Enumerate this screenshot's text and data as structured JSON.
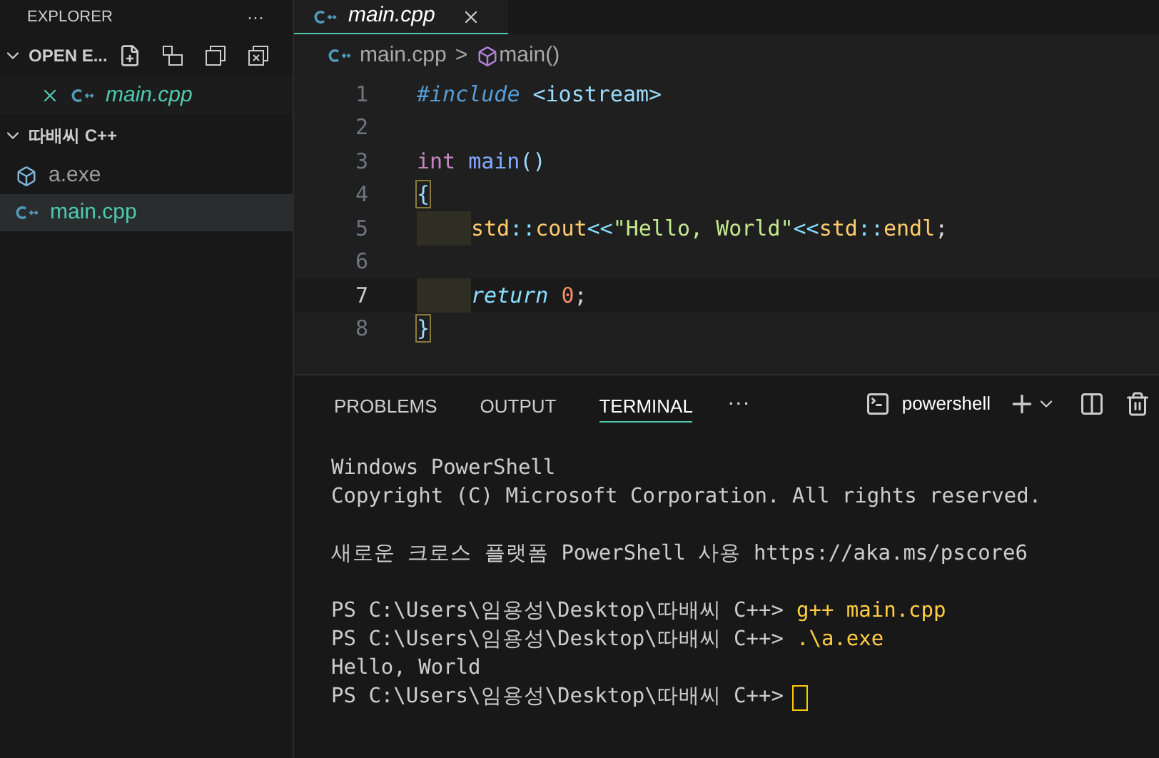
{
  "sidebar": {
    "title": "EXPLORER",
    "more": "···",
    "sections": [
      {
        "title": "OPEN E...",
        "expanded": true,
        "actions": true,
        "items": [
          {
            "kind": "cpp",
            "name": "main.cpp",
            "closable": true,
            "italic": true,
            "selected": false
          }
        ]
      },
      {
        "title": "따배씨 C++",
        "expanded": true,
        "items": [
          {
            "kind": "exe",
            "name": "a.exe",
            "closable": false,
            "italic": false,
            "selected": false
          },
          {
            "kind": "cpp",
            "name": "main.cpp",
            "closable": false,
            "italic": false,
            "selected": true
          }
        ]
      }
    ]
  },
  "editor": {
    "tabs": [
      {
        "name": "main.cpp",
        "selected": true
      }
    ],
    "breadcrumb": {
      "file": "main.cpp",
      "separator": ">",
      "symbol": "main()"
    },
    "lines": [
      {
        "number": "1",
        "indented": false,
        "current": false,
        "tokens": [
          {
            "kind": "directive",
            "text": "#include"
          },
          {
            "kind": "header",
            "text": "<iostream>",
            "space_before": true
          }
        ]
      },
      {
        "number": "2",
        "indented": false,
        "current": false
      },
      {
        "number": "3",
        "indented": false,
        "current": false,
        "tokens": [
          {
            "kind": "type",
            "text": "int"
          },
          {
            "kind": "function",
            "text": "main",
            "space_before": true
          },
          {
            "kind": "punct",
            "text": "()"
          }
        ]
      },
      {
        "number": "4",
        "indented": false,
        "current": false,
        "tokens": [
          {
            "kind": "bracket",
            "text": "{"
          }
        ]
      },
      {
        "number": "5",
        "indented": true,
        "current": false,
        "tokens": [
          {
            "kind": "namespace",
            "text": "std"
          },
          {
            "kind": "operator",
            "text": "::"
          },
          {
            "kind": "namespace",
            "text": "cout"
          },
          {
            "kind": "operator",
            "text": "<<"
          },
          {
            "kind": "string",
            "text": "\"Hello, World\""
          },
          {
            "kind": "operator",
            "text": "<<"
          },
          {
            "kind": "namespace",
            "text": "std"
          },
          {
            "kind": "operator",
            "text": "::"
          },
          {
            "kind": "namespace",
            "text": "endl"
          },
          {
            "kind": "plain",
            "text": ";"
          }
        ]
      },
      {
        "number": "6",
        "indented": false,
        "current": false
      },
      {
        "number": "7",
        "indented": true,
        "current": true,
        "tokens": [
          {
            "kind": "control",
            "text": "return"
          },
          {
            "kind": "number",
            "text": "0",
            "space_before": true
          },
          {
            "kind": "plain",
            "text": ";"
          }
        ]
      },
      {
        "number": "8",
        "indented": false,
        "current": false,
        "tokens": [
          {
            "kind": "bracket",
            "text": "}"
          }
        ]
      }
    ]
  },
  "panel": {
    "tabs": [
      {
        "label": "PROBLEMS",
        "selected": false
      },
      {
        "label": "OUTPUT",
        "selected": false
      },
      {
        "label": "TERMINAL",
        "selected": true
      }
    ],
    "more": "···",
    "shell": "powershell",
    "terminal": [
      {
        "lines": [
          {
            "segments": [
              {
                "kind": "output",
                "text": "Windows PowerShell"
              }
            ]
          },
          {
            "segments": [
              {
                "kind": "output",
                "text": "Copyright (C) Microsoft Corporation. All rights reserved."
              }
            ]
          }
        ]
      },
      {
        "lines": [
          {
            "segments": [
              {
                "kind": "output",
                "text": "새로운 크로스 플랫폼 PowerShell 사용 https://aka.ms/pscore6"
              }
            ]
          }
        ]
      },
      {
        "lines": [
          {
            "segments": [
              {
                "kind": "output",
                "text": "PS C:\\Users\\임용성\\Desktop\\따배씨 C++>"
              },
              {
                "kind": "command",
                "text": "g++ main.cpp"
              }
            ]
          },
          {
            "segments": [
              {
                "kind": "output",
                "text": "PS C:\\Users\\임용성\\Desktop\\따배씨 C++>"
              },
              {
                "kind": "command",
                "text": ".\\a.exe"
              }
            ]
          },
          {
            "segments": [
              {
                "kind": "output",
                "text": "Hello, World"
              }
            ]
          },
          {
            "segments": [
              {
                "kind": "output",
                "text": "PS C:\\Users\\임용성\\Desktop\\따배씨 C++>"
              },
              {
                "kind": "cursor"
              }
            ]
          }
        ]
      }
    ]
  }
}
